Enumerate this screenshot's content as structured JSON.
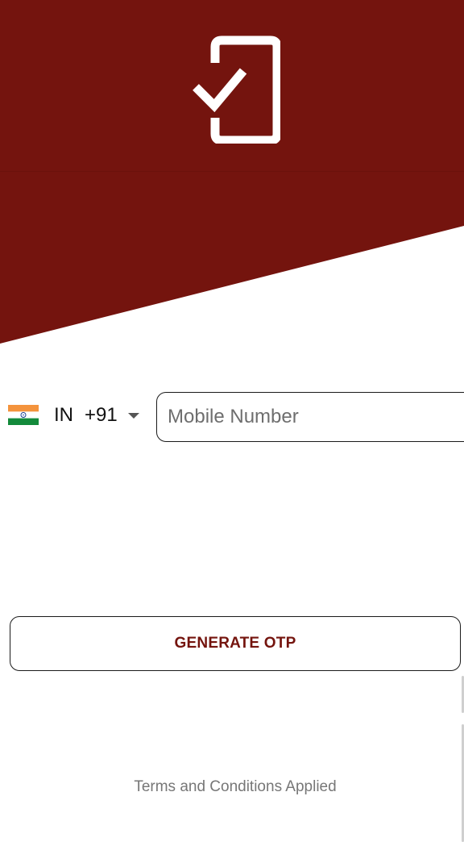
{
  "header": {
    "icon": "phone-check-icon",
    "background_color": "#74140e"
  },
  "country_picker": {
    "flag_icon": "india-flag-icon",
    "country_code": "IN",
    "dial_code": "+91",
    "arrow_icon": "dropdown-arrow-icon"
  },
  "mobile_input": {
    "placeholder": "Mobile Number",
    "value": ""
  },
  "generate_button": {
    "label": "GENERATE OTP",
    "text_color": "#74140e"
  },
  "footer": {
    "terms_text": "Terms and Conditions Applied"
  }
}
